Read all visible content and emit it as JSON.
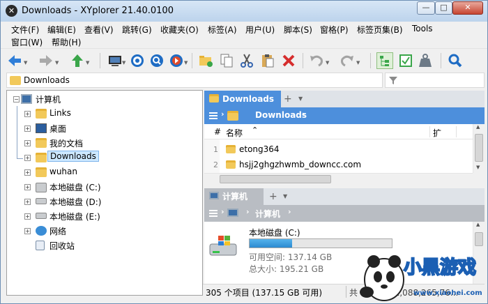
{
  "window": {
    "title": "Downloads - XYplorer 21.40.0100",
    "buttons": {
      "minimize": "—",
      "maximize": "□",
      "close": "✕"
    }
  },
  "menu": {
    "row1": [
      "文件(F)",
      "编辑(E)",
      "查看(V)",
      "跳转(G)",
      "收藏夹(O)",
      "标签(A)",
      "用户(U)",
      "脚本(S)",
      "窗格(P)",
      "标签页集(B)",
      "Tools"
    ],
    "row2": [
      "窗口(W)",
      "帮助(H)"
    ]
  },
  "toolbar": {
    "icons": [
      "back-icon",
      "forward-icon",
      "up-icon",
      "computer-icon",
      "target-icon",
      "search-globe-icon",
      "go-icon",
      "new-folder-icon",
      "copy-icon",
      "cut-icon",
      "paste-icon",
      "delete-icon",
      "undo-icon",
      "redo-icon",
      "tree-view-icon",
      "checkbox-icon",
      "weight-icon",
      "find-icon"
    ]
  },
  "address": {
    "path": "Downloads"
  },
  "tree": {
    "root": "计算机",
    "items": [
      {
        "label": "Links",
        "icon": "folder"
      },
      {
        "label": "桌面",
        "icon": "desktop"
      },
      {
        "label": "我的文档",
        "icon": "folder"
      },
      {
        "label": "Downloads",
        "icon": "folder",
        "selected": true
      },
      {
        "label": "wuhan",
        "icon": "folder"
      },
      {
        "label": "本地磁盘 (C:)",
        "icon": "drive-c"
      },
      {
        "label": "本地磁盘 (D:)",
        "icon": "drive"
      },
      {
        "label": "本地磁盘 (E:)",
        "icon": "drive"
      },
      {
        "label": "网络",
        "icon": "network"
      },
      {
        "label": "回收站",
        "icon": "recycle-bin"
      }
    ]
  },
  "pane1": {
    "tab": "Downloads",
    "breadcrumb": "Downloads",
    "columns": {
      "num": "#",
      "name": "名称",
      "ext": "扩"
    },
    "rows": [
      {
        "num": "1",
        "name": "etong364"
      },
      {
        "num": "2",
        "name": "hsjj2ghgzhwmb_downcc.com"
      }
    ]
  },
  "pane2": {
    "tab": "计算机",
    "breadcrumb": "计算机",
    "drive": {
      "name": "本地磁盘 (C:)",
      "used_fraction": 0.3,
      "free": "可用空间: 137.14 GB",
      "total": "总大小: 195.21 GB"
    }
  },
  "status": {
    "items": "305 个项目 (137.15 GB 可用)",
    "total": "共 ...0 GB (2,088,265,76..."
  },
  "watermark": {
    "text": "小黑游戏",
    "url": "www.xiaohei.com"
  },
  "colors": {
    "accent": "#4d8fdc",
    "tab_inactive": "#b9bdc3",
    "folder": "#f2c95a"
  }
}
